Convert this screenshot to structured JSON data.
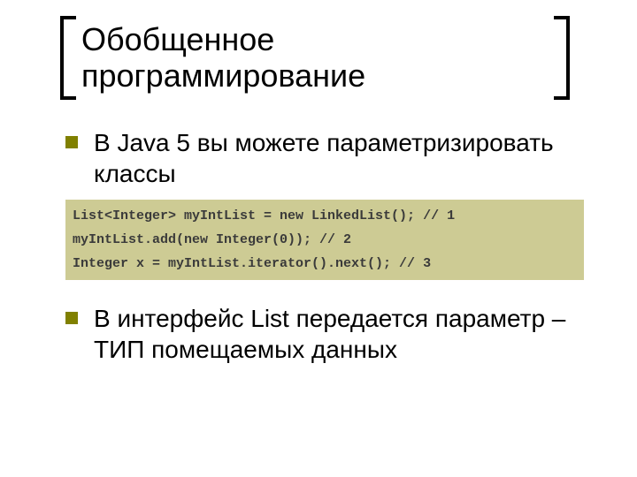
{
  "title": "Обобщенное программирование",
  "bullets": {
    "first": "В Java 5 вы можете параметризировать классы",
    "second": "В интерфейс List передается параметр – ТИП помещаемых данных"
  },
  "code": {
    "line1": "List<Integer> myIntList = new LinkedList(); // 1",
    "line2": "myIntList.add(new Integer(0)); // 2",
    "line3": "Integer x = myIntList.iterator().next(); // 3"
  }
}
